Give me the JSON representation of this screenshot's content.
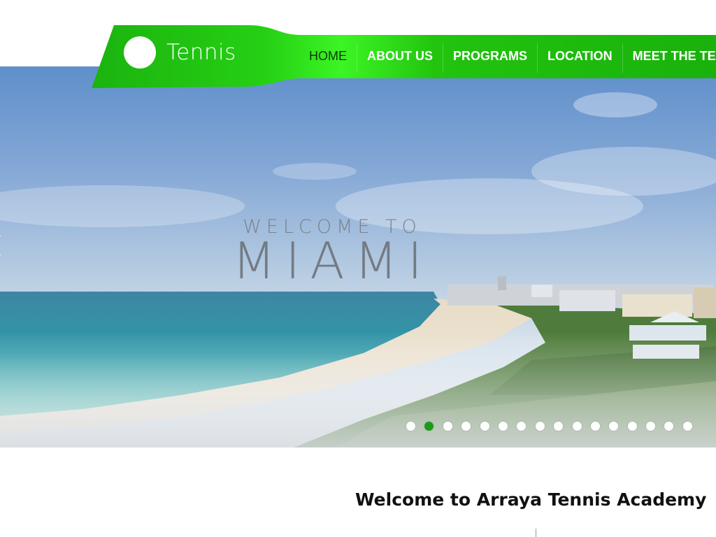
{
  "header": {
    "logo_text": "Tennis",
    "nav": [
      {
        "label": "HOME",
        "active": true
      },
      {
        "label": "ABOUT US",
        "active": false
      },
      {
        "label": "PROGRAMS",
        "active": false
      },
      {
        "label": "LOCATION",
        "active": false
      },
      {
        "label": "MEET THE TEAM",
        "active": false
      }
    ]
  },
  "hero": {
    "title_line1": "WELCOME TO",
    "title_line2": "MIAMI",
    "slide_count": 16,
    "active_slide": 2
  },
  "content": {
    "welcome_heading": "Welcome to Arraya Tennis Academy"
  },
  "colors": {
    "brand_green": "#22c90f",
    "active_dot": "#1a9c1a",
    "nav_text": "#ffffff",
    "nav_active_text": "#0a3a0a"
  }
}
